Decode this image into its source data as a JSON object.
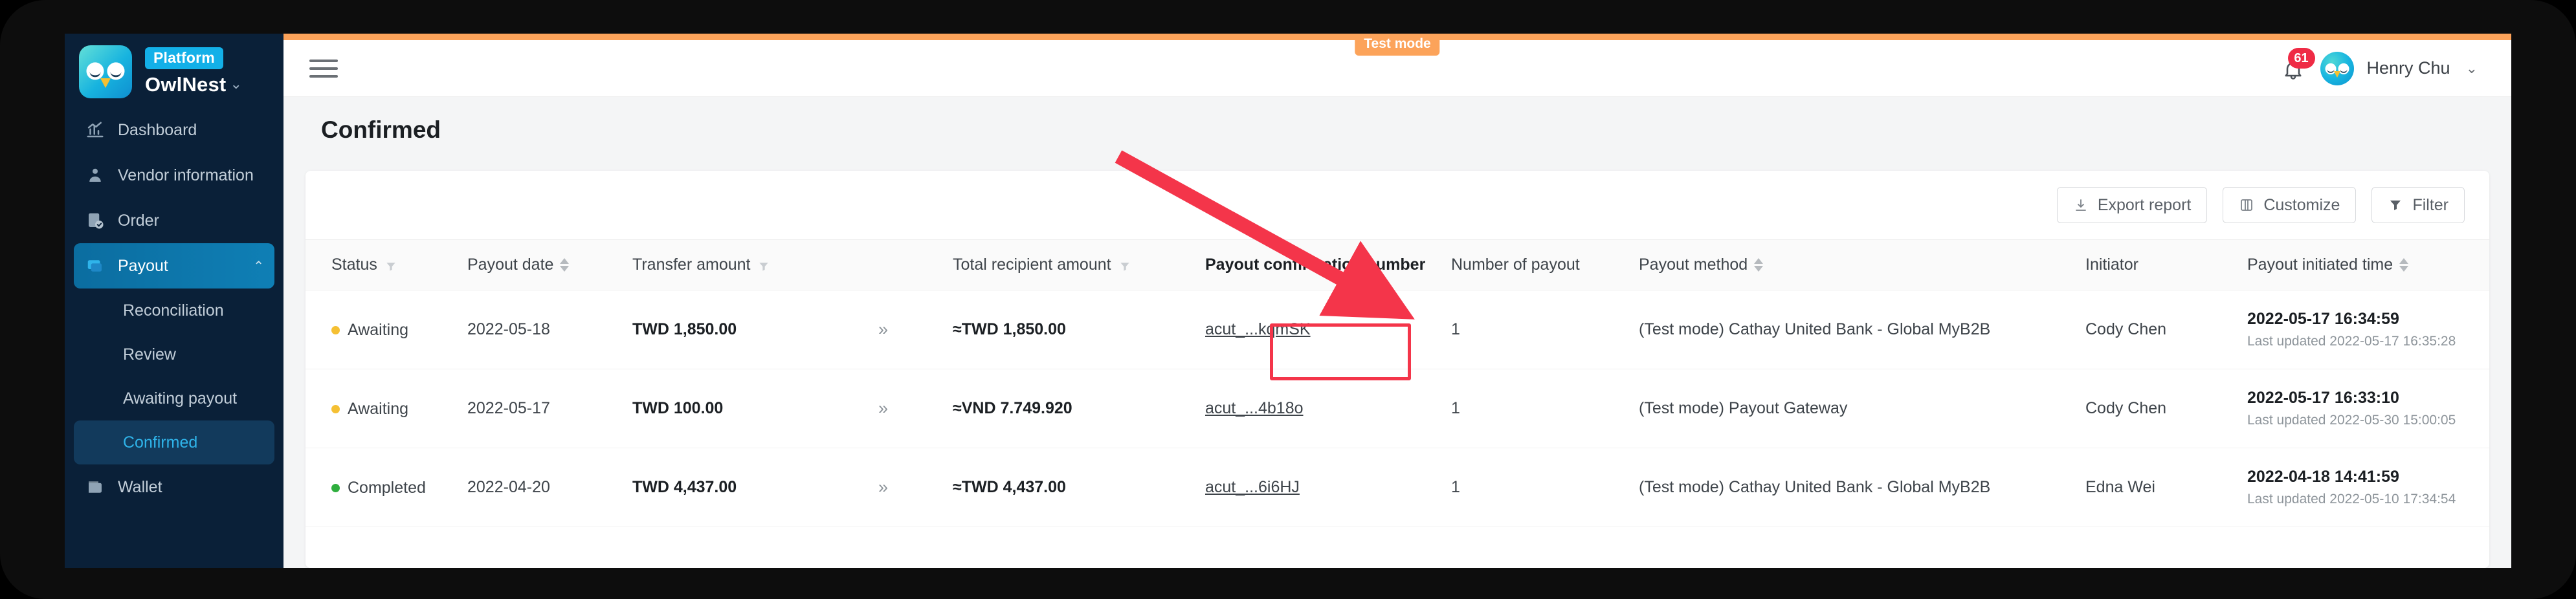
{
  "sidebar": {
    "brand": {
      "badge": "Platform",
      "name": "OwlNest",
      "caret": "⌄"
    },
    "items": [
      {
        "label": "Dashboard",
        "icon": "chart-icon"
      },
      {
        "label": "Vendor information",
        "icon": "vendor-icon"
      },
      {
        "label": "Order",
        "icon": "order-icon"
      },
      {
        "label": "Payout",
        "icon": "payout-icon",
        "active": true,
        "caret": "⌃"
      },
      {
        "label": "Wallet",
        "icon": "wallet-icon"
      }
    ],
    "payout_subitems": [
      {
        "label": "Reconciliation"
      },
      {
        "label": "Review"
      },
      {
        "label": "Awaiting payout"
      },
      {
        "label": "Confirmed",
        "current": true
      }
    ]
  },
  "topbar": {
    "test_mode": "Test mode",
    "notification_count": "61",
    "user_name": "Henry Chu",
    "user_caret": "⌄"
  },
  "page": {
    "title": "Confirmed"
  },
  "toolbar": {
    "export_label": "Export report",
    "customize_label": "Customize",
    "filter_label": "Filter"
  },
  "table": {
    "columns": [
      {
        "label": "Status",
        "filter": true,
        "sort": false
      },
      {
        "label": "Payout date",
        "filter": false,
        "sort": true
      },
      {
        "label": "Transfer amount",
        "filter": true,
        "sort": false
      },
      {
        "label": "",
        "filter": false,
        "sort": false
      },
      {
        "label": "Total recipient amount",
        "filter": true,
        "sort": false
      },
      {
        "label": "Payout confirmation number",
        "filter": false,
        "sort": false,
        "bold": true
      },
      {
        "label": "Number of payout",
        "filter": false,
        "sort": false
      },
      {
        "label": "Payout method",
        "filter": false,
        "sort": true
      },
      {
        "label": "Initiator",
        "filter": false,
        "sort": false
      },
      {
        "label": "Payout initiated time",
        "filter": false,
        "sort": true
      }
    ],
    "rows": [
      {
        "status": "Awaiting",
        "status_color": "#f5c033",
        "payout_date": "2022-05-18",
        "transfer_amount": "TWD 1,850.00",
        "arrow": "»",
        "total_recipient_amount": "≈TWD 1,850.00",
        "confirmation_number": "acut_...kqmSK",
        "number_of_payout": "1",
        "payout_method": "(Test mode) Cathay United Bank - Global MyB2B",
        "initiator": "Cody Chen",
        "initiated_time": "2022-05-17 16:34:59",
        "last_updated": "Last updated 2022-05-17 16:35:28",
        "highlighted": true
      },
      {
        "status": "Awaiting",
        "status_color": "#f5c033",
        "payout_date": "2022-05-17",
        "transfer_amount": "TWD 100.00",
        "arrow": "»",
        "total_recipient_amount": "≈VND  7.749.920",
        "confirmation_number": "acut_...4b18o",
        "number_of_payout": "1",
        "payout_method": "(Test mode) Payout Gateway",
        "initiator": "Cody Chen",
        "initiated_time": "2022-05-17 16:33:10",
        "last_updated": "Last updated 2022-05-30 15:00:05",
        "highlighted": false
      },
      {
        "status": "Completed",
        "status_color": "#2fae3e",
        "payout_date": "2022-04-20",
        "transfer_amount": "TWD 4,437.00",
        "arrow": "»",
        "total_recipient_amount": "≈TWD 4,437.00",
        "confirmation_number": "acut_...6i6HJ",
        "number_of_payout": "1",
        "payout_method": "(Test mode) Cathay United Bank - Global MyB2B",
        "initiator": "Edna Wei",
        "initiated_time": "2022-04-18 14:41:59",
        "last_updated": "Last updated 2022-05-10 17:34:54",
        "highlighted": false
      }
    ]
  },
  "annotation": {
    "arrow_color": "#f4354a",
    "highlight_color": "#f4354a",
    "target": "payout-confirmation-number-link-row-1"
  },
  "colors": {
    "sidebar_bg": "#0a2038",
    "accent": "#13b0e8",
    "test_mode": "#fca35a",
    "notification": "#ef2b45"
  }
}
